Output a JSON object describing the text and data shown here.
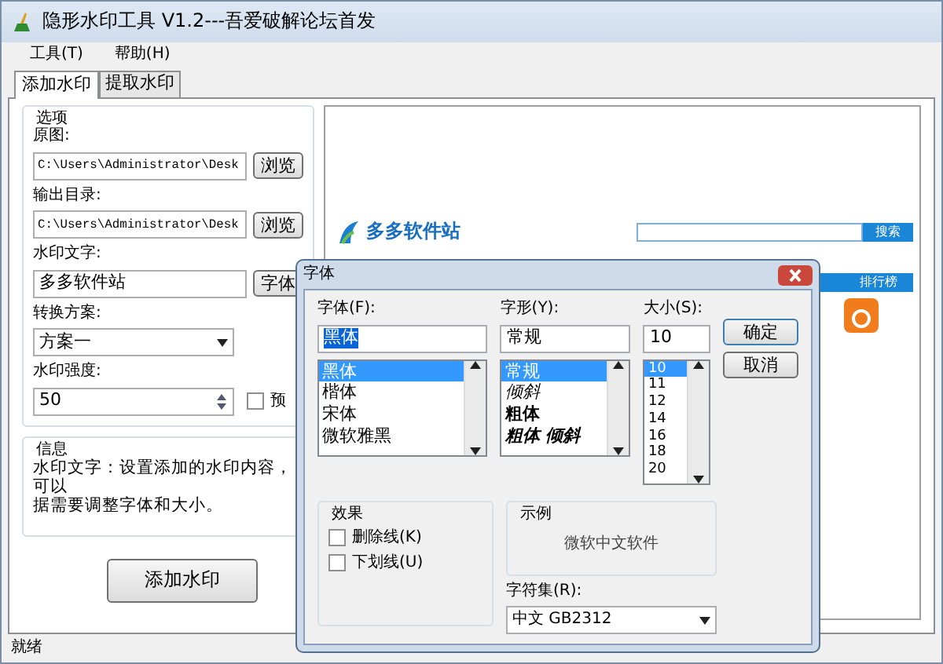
{
  "window": {
    "title": "隐形水印工具 V1.2---吾爱破解论坛首发"
  },
  "menu": [
    {
      "label": "工具(T)"
    },
    {
      "label": "帮助(H)"
    }
  ],
  "tabs": [
    {
      "label": "添加水印",
      "selected": true
    },
    {
      "label": "提取水印",
      "selected": false
    }
  ],
  "options": {
    "title": "选项",
    "source": {
      "label": "原图:",
      "value": "C:\\Users\\Administrator\\Desk",
      "button": "浏览"
    },
    "output": {
      "label": "输出目录:",
      "value": "C:\\Users\\Administrator\\Desk",
      "button": "浏览"
    },
    "text": {
      "label": "水印文字:",
      "value": "多多软件站",
      "button": "字体"
    },
    "scheme": {
      "label": "转换方案:",
      "value": "方案一"
    },
    "strength": {
      "label": "水印强度:",
      "value": "50"
    },
    "preview_check": {
      "label": "预",
      "checked": false
    }
  },
  "info": {
    "title": "信息",
    "lines": [
      "水印文字：设置添加的水印内容，可以",
      "据需要调整字体和大小。"
    ]
  },
  "add_button": "添加水印",
  "status_bar": "就绪",
  "preview": {
    "logo": "多多软件站",
    "search_button": "搜索",
    "nav": "排行榜"
  },
  "font_dialog": {
    "title": "字体",
    "font": {
      "label": "字体(F):",
      "value": "黑体",
      "items": [
        {
          "label": "黑体",
          "selected": true
        },
        {
          "label": "楷体",
          "selected": false
        },
        {
          "label": "宋体",
          "selected": false
        },
        {
          "label": "微软雅黑",
          "selected": false
        }
      ]
    },
    "style": {
      "label": "字形(Y):",
      "value": "常规",
      "items": [
        {
          "label": "常规",
          "selected": true
        },
        {
          "label": "倾斜",
          "selected": false,
          "kind": "italic"
        },
        {
          "label": "粗体",
          "selected": false,
          "kind": "bold"
        },
        {
          "label": "粗体 倾斜",
          "selected": false,
          "kind": "bolditalic"
        }
      ]
    },
    "size": {
      "label": "大小(S):",
      "value": "10",
      "items": [
        {
          "label": "10",
          "selected": true
        },
        {
          "label": "11",
          "selected": false
        },
        {
          "label": "12",
          "selected": false
        },
        {
          "label": "14",
          "selected": false
        },
        {
          "label": "16",
          "selected": false
        },
        {
          "label": "18",
          "selected": false
        },
        {
          "label": "20",
          "selected": false
        }
      ]
    },
    "ok": "确定",
    "cancel": "取消",
    "effects": {
      "title": "效果",
      "items": [
        {
          "label": "删除线(K)",
          "checked": false
        },
        {
          "label": "下划线(U)",
          "checked": false
        }
      ]
    },
    "sample": {
      "title": "示例",
      "text": "微软中文软件"
    },
    "charset": {
      "label": "字符集(R):",
      "value": "中文 GB2312"
    }
  }
}
